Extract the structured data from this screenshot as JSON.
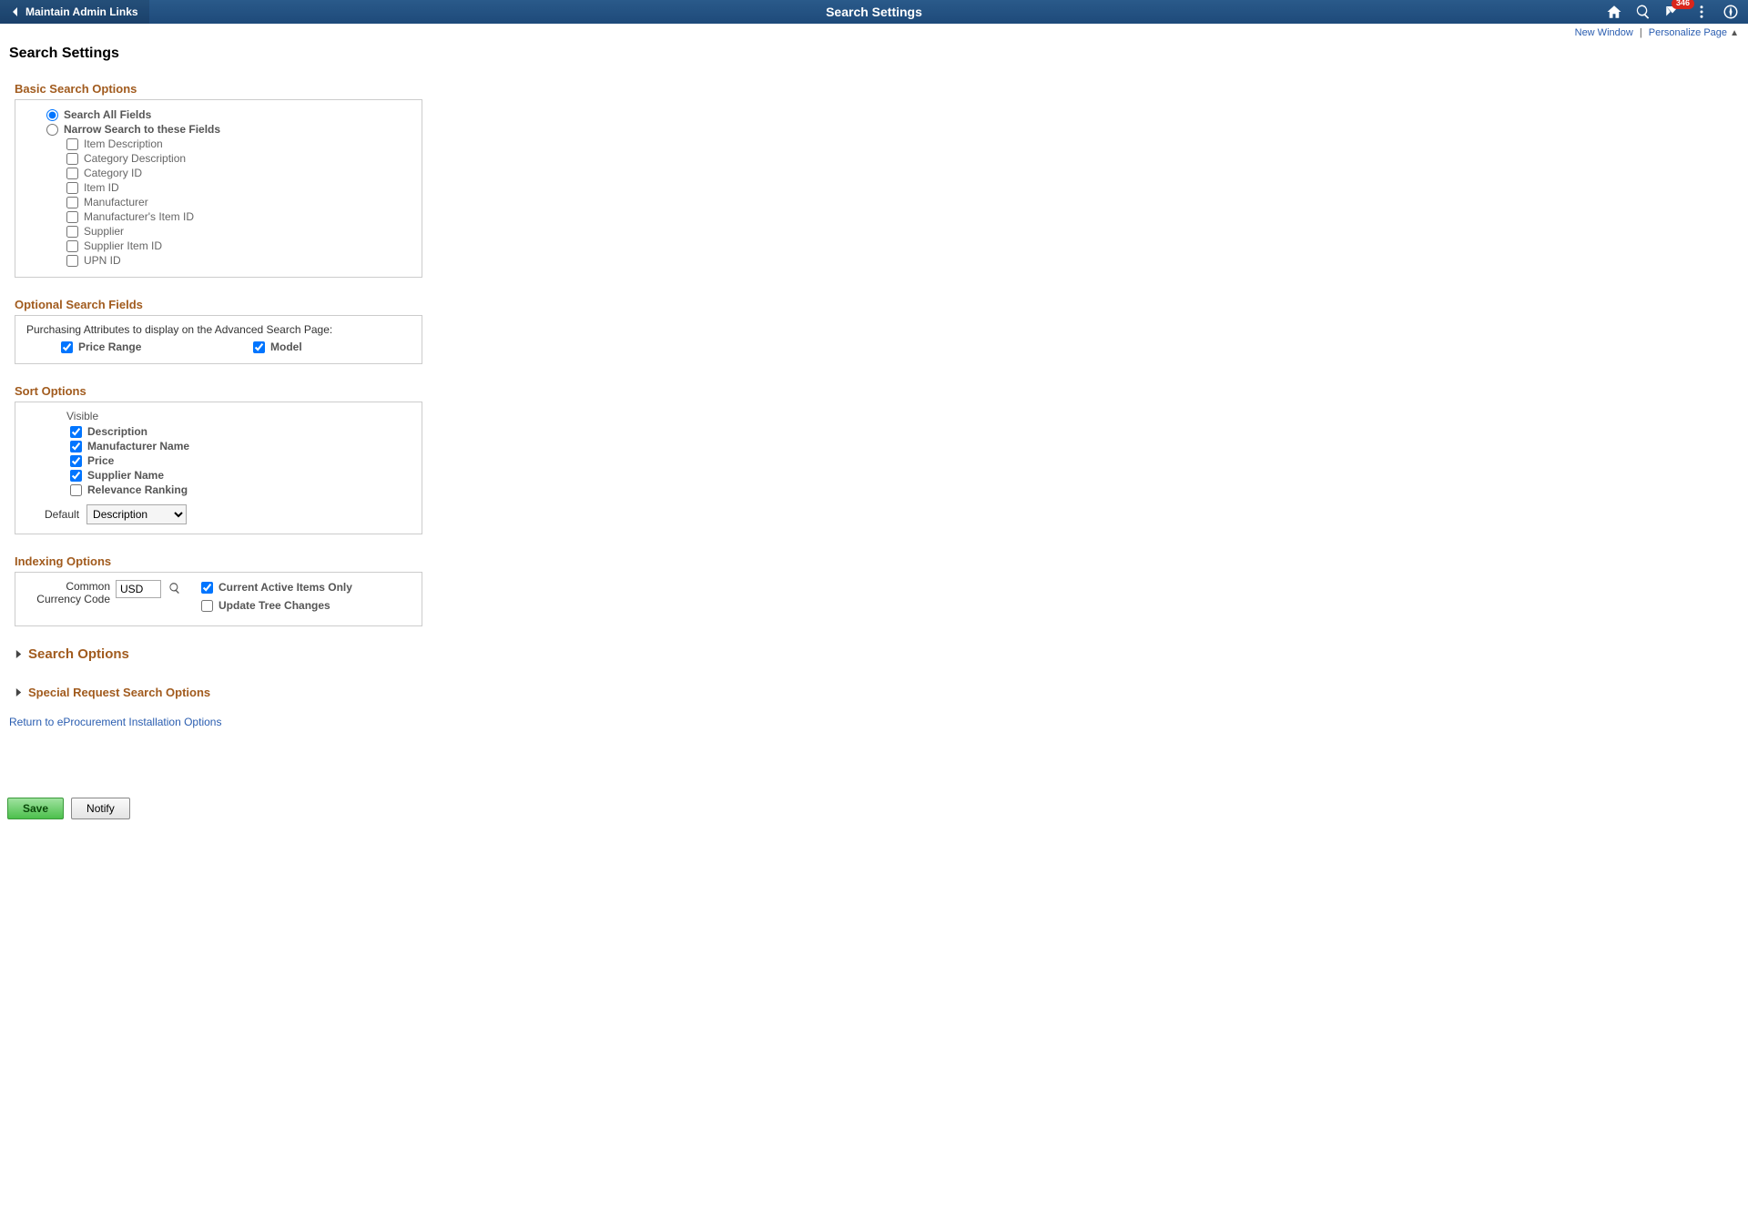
{
  "header": {
    "breadcrumb": "Maintain Admin Links",
    "title": "Search Settings",
    "notif_count": "346"
  },
  "links": {
    "new_window": "New Window",
    "personalize": "Personalize Page"
  },
  "page_heading": "Search Settings",
  "basic": {
    "title": "Basic Search Options",
    "radio_all": "Search All Fields",
    "radio_narrow": "Narrow Search to these Fields",
    "fields": {
      "item_description": "Item Description",
      "category_description": "Category Description",
      "category_id": "Category ID",
      "item_id": "Item ID",
      "manufacturer": "Manufacturer",
      "manufacturer_item_id": "Manufacturer's Item ID",
      "supplier": "Supplier",
      "supplier_item_id": "Supplier Item ID",
      "upn_id": "UPN ID"
    }
  },
  "optional": {
    "title": "Optional Search Fields",
    "msg": "Purchasing Attributes to display on the Advanced Search Page:",
    "price_range": "Price Range",
    "model": "Model"
  },
  "sort": {
    "title": "Sort Options",
    "visible_header": "Visible",
    "description": "Description",
    "manufacturer_name": "Manufacturer Name",
    "price": "Price",
    "supplier_name": "Supplier Name",
    "relevance": "Relevance Ranking",
    "default_label": "Default",
    "default_value": "Description"
  },
  "indexing": {
    "title": "Indexing Options",
    "currency_label": "Common Currency Code",
    "currency_value": "USD",
    "active_only": "Current Active Items Only",
    "update_tree": "Update Tree Changes"
  },
  "collapsible": {
    "search_options": "Search Options",
    "special_request": "Special Request Search Options"
  },
  "return_link": "Return to eProcurement Installation Options",
  "buttons": {
    "save": "Save",
    "notify": "Notify"
  }
}
